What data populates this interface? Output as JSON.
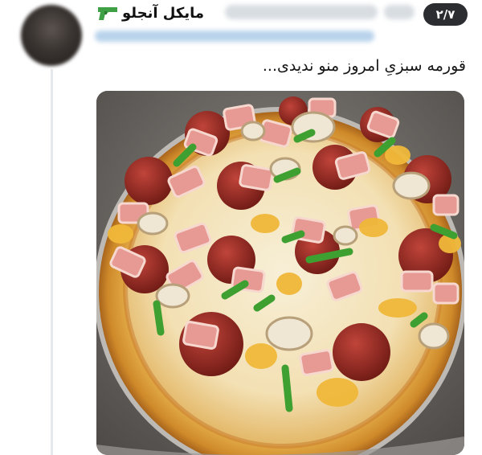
{
  "post": {
    "display_name": "مایکل آنجلو",
    "display_name_icon": "pistol-icon",
    "page_indicator": "۲/۷",
    "text": "قورمه سبزیِ امروز منو ندیدی...",
    "media_alt": "pizza-photo"
  },
  "colors": {
    "badge_bg": "#2b2d31",
    "badge_text": "#ffffff",
    "pistol_green": "#3fa046",
    "blurred_handle": "#b9d3ec"
  }
}
